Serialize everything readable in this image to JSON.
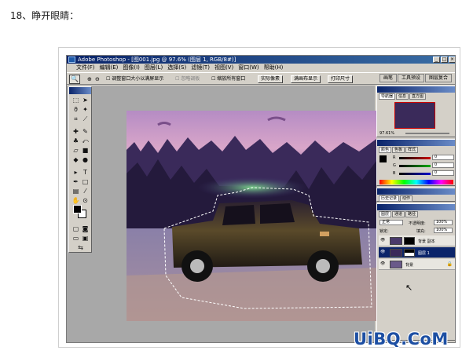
{
  "step": {
    "heading": "18、睁开眼睛："
  },
  "window": {
    "title": "Adobe Photoshop - [图001.jpg @ 97.6% (图层 1, RGB/8#)]",
    "controls": [
      "_",
      "□",
      "×"
    ]
  },
  "menu": [
    "文件(F)",
    "编辑(E)",
    "图像(I)",
    "图层(L)",
    "选择(S)",
    "滤镜(T)",
    "视图(V)",
    "窗口(W)",
    "帮助(H)"
  ],
  "options_bar": {
    "zoom_icons": [
      "⊕",
      "⊖"
    ],
    "resize_windows": "调整窗口大小以满屏显示",
    "ignore_palettes": "忽略调板",
    "zoom_all": "缩放所有窗口",
    "actual_pixels": "实际像素",
    "fit_screen": "满画布显示",
    "print_size": "打印尺寸",
    "tabs": [
      "画笔",
      "工具预设",
      "图层复合"
    ]
  },
  "navigator": {
    "tabs": [
      "导航器",
      "信息",
      "直方图"
    ],
    "zoom": "97.61%"
  },
  "color": {
    "tabs": [
      "颜色",
      "色板",
      "样式"
    ],
    "channels": [
      {
        "label": "R",
        "value": "0"
      },
      {
        "label": "G",
        "value": "0"
      },
      {
        "label": "B",
        "value": "0"
      }
    ]
  },
  "history": {
    "tabs": [
      "历史记录",
      "动作"
    ]
  },
  "layers": {
    "tabs": [
      "图层",
      "通道",
      "路径"
    ],
    "blend_mode": "正常",
    "opacity_label": "不透明度:",
    "opacity": "100%",
    "lock_label": "锁定:",
    "fill_label": "填充:",
    "fill": "100%",
    "items": [
      {
        "name": "背景 副本",
        "selected": false
      },
      {
        "name": "图层 1",
        "selected": true
      },
      {
        "name": "背景",
        "selected": false
      }
    ]
  },
  "watermark": "UiBQ.CoM",
  "colors": {
    "title": "#0a246a",
    "ui": "#d4d0c8",
    "workspace": "#a8a8a8",
    "watermark": "#1d4fa3"
  }
}
